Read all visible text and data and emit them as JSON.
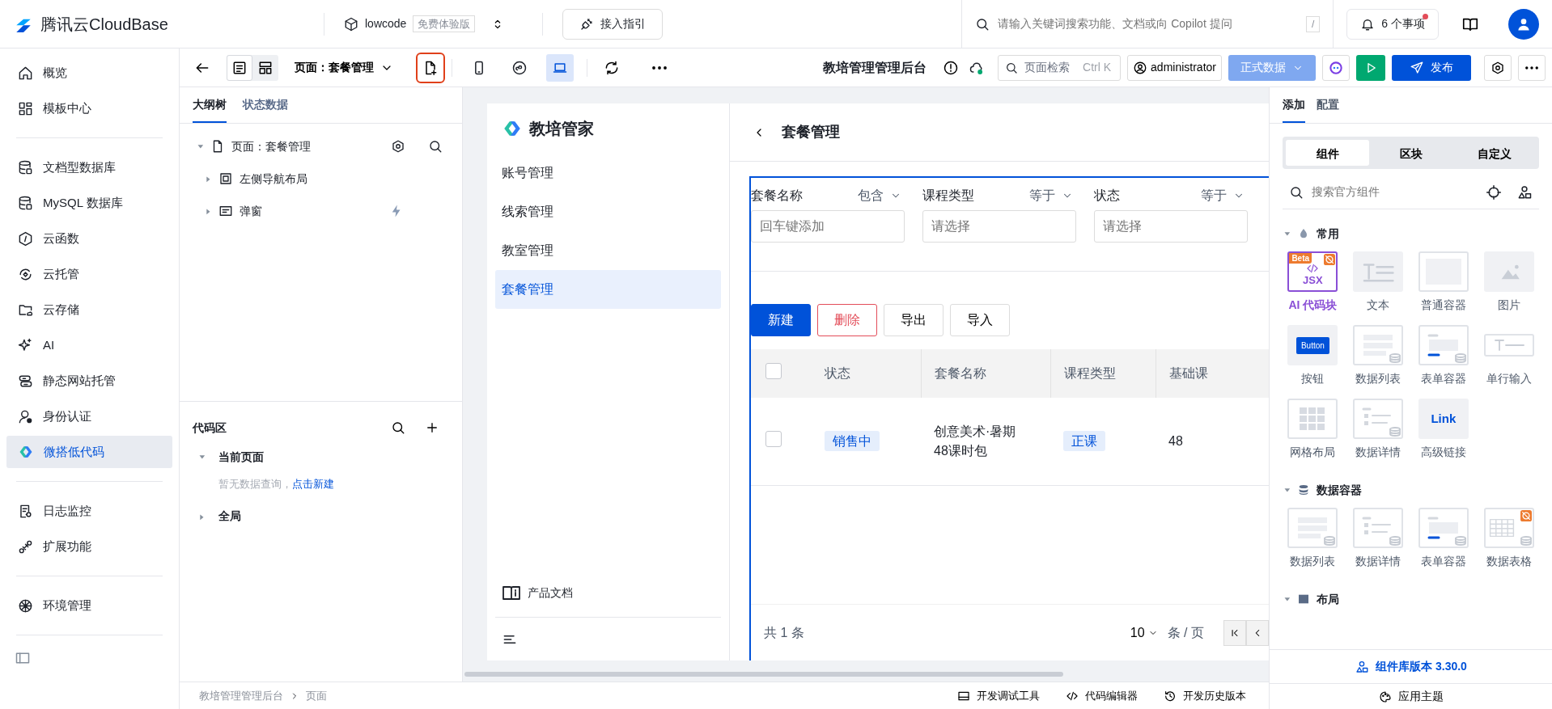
{
  "topbar": {
    "brand": "腾讯云CloudBase",
    "env_name": "lowcode",
    "env_badge": "免费体验版",
    "guide_button": "接入指引",
    "search_placeholder": "请输入关键词搜索功能、文档或向 Copilot 提问",
    "search_shortcut": "/",
    "notifications": "6 个事项",
    "has_unread": true
  },
  "nav": {
    "groups": [
      [
        {
          "label": "概览",
          "selected": false
        },
        {
          "label": "模板中心",
          "selected": false
        }
      ],
      [
        {
          "label": "文档型数据库",
          "selected": false
        },
        {
          "label": "MySQL 数据库",
          "selected": false
        },
        {
          "label": "云函数",
          "selected": false
        },
        {
          "label": "云托管",
          "selected": false
        },
        {
          "label": "云存储",
          "selected": false
        },
        {
          "label": "AI",
          "selected": false
        },
        {
          "label": "静态网站托管",
          "selected": false
        },
        {
          "label": "身份认证",
          "selected": false
        },
        {
          "label": "微搭低代码",
          "selected": true
        }
      ],
      [
        {
          "label": "日志监控",
          "selected": false
        },
        {
          "label": "扩展功能",
          "selected": false
        }
      ],
      [
        {
          "label": "环境管理",
          "selected": false
        }
      ]
    ]
  },
  "toolbar": {
    "view_modes": [
      {
        "selected": true
      },
      {
        "selected": false
      }
    ],
    "page_selector": "页面：套餐管理",
    "add_page_highlighted": true,
    "devices": [
      {
        "selected": false
      },
      {
        "selected": false
      },
      {
        "selected": true
      }
    ],
    "app_title": "教培管理管理后台",
    "page_search": "页面检索",
    "page_search_shortcut": "Ctrl K",
    "user": "administrator",
    "data_env": "正式数据",
    "publish": "发布"
  },
  "outline": {
    "tabs": [
      {
        "label": "大纲树",
        "selected": true
      },
      {
        "label": "状态数据",
        "selected": false
      }
    ],
    "tree": [
      {
        "label": "页面：套餐管理",
        "expanded": true,
        "children": [
          {
            "label": "左侧导航布局",
            "expanded": false
          },
          {
            "label": "弹窗",
            "expanded": false
          }
        ]
      }
    ]
  },
  "code_area": {
    "title": "代码区",
    "sections": [
      {
        "label": "当前页面",
        "expanded": true,
        "empty_text": "暂无数据查询，",
        "link": "点击新建"
      },
      {
        "label": "全局",
        "expanded": false
      }
    ]
  },
  "breadcrumb": [
    "教培管理管理后台",
    "页面"
  ],
  "preview": {
    "brand": "教培管家",
    "menu": [
      {
        "label": "账号管理",
        "selected": false
      },
      {
        "label": "线索管理",
        "selected": false
      },
      {
        "label": "教室管理",
        "selected": false
      },
      {
        "label": "套餐管理",
        "selected": true
      }
    ],
    "docs": "产品文档",
    "page_title": "套餐管理",
    "filters": [
      {
        "label": "套餐名称",
        "op": "包含",
        "placeholder": "回车键添加"
      },
      {
        "label": "课程类型",
        "op": "等于",
        "placeholder": "请选择"
      },
      {
        "label": "状态",
        "op": "等于",
        "placeholder": "请选择"
      }
    ],
    "buttons": [
      {
        "label": "新建",
        "kind": "primary"
      },
      {
        "label": "删除",
        "kind": "danger"
      },
      {
        "label": "导出",
        "kind": "default"
      },
      {
        "label": "导入",
        "kind": "default"
      }
    ],
    "table": {
      "header_checked": false,
      "columns": [
        "状态",
        "套餐名称",
        "课程类型",
        "基础课"
      ],
      "rows": [
        {
          "checked": false,
          "cells": [
            "销售中",
            "创意美术·暑期48课时包",
            "正课",
            "48"
          ]
        }
      ]
    },
    "total": "共 1 条",
    "page_size": "10",
    "page_size_unit": "条 / 页"
  },
  "bottom_tools": [
    "开发调试工具",
    "代码编辑器",
    "开发历史版本"
  ],
  "components": {
    "tabs": [
      {
        "label": "添加",
        "selected": true
      },
      {
        "label": "配置",
        "selected": false
      }
    ],
    "segments": [
      {
        "label": "组件",
        "selected": true
      },
      {
        "label": "区块",
        "selected": false
      },
      {
        "label": "自定义",
        "selected": false
      }
    ],
    "search_placeholder": "搜索官方组件",
    "groups": [
      {
        "title": "常用",
        "expanded": true,
        "items": [
          {
            "label": "AI 代码块",
            "kind": "jsx",
            "preview_text": "JSX",
            "badge": "Beta",
            "hot": true
          },
          {
            "label": "文本",
            "kind": "text",
            "hot": false
          },
          {
            "label": "普通容器",
            "kind": "container",
            "hot": false
          },
          {
            "label": "图片",
            "kind": "image",
            "hot": false
          },
          {
            "label": "按钮",
            "kind": "button",
            "preview_text": "Button",
            "hot": false
          },
          {
            "label": "数据列表",
            "kind": "list",
            "hot": false
          },
          {
            "label": "表单容器",
            "kind": "form",
            "hot": false
          },
          {
            "label": "单行输入",
            "kind": "input",
            "hot": false
          },
          {
            "label": "网格布局",
            "kind": "grid",
            "hot": false
          },
          {
            "label": "数据详情",
            "kind": "detail",
            "hot": false
          },
          {
            "label": "高级链接",
            "kind": "link",
            "preview_text": "Link",
            "hot": false
          }
        ]
      },
      {
        "title": "数据容器",
        "expanded": true,
        "items": [
          {
            "label": "数据列表",
            "kind": "list",
            "hot": false
          },
          {
            "label": "数据详情",
            "kind": "detail",
            "hot": false
          },
          {
            "label": "表单容器",
            "kind": "form",
            "hot": false
          },
          {
            "label": "数据表格",
            "kind": "table",
            "hot": true
          }
        ]
      },
      {
        "title": "布局",
        "expanded": true
      }
    ],
    "version": "组件库版本 3.30.0",
    "theme": "应用主题"
  }
}
